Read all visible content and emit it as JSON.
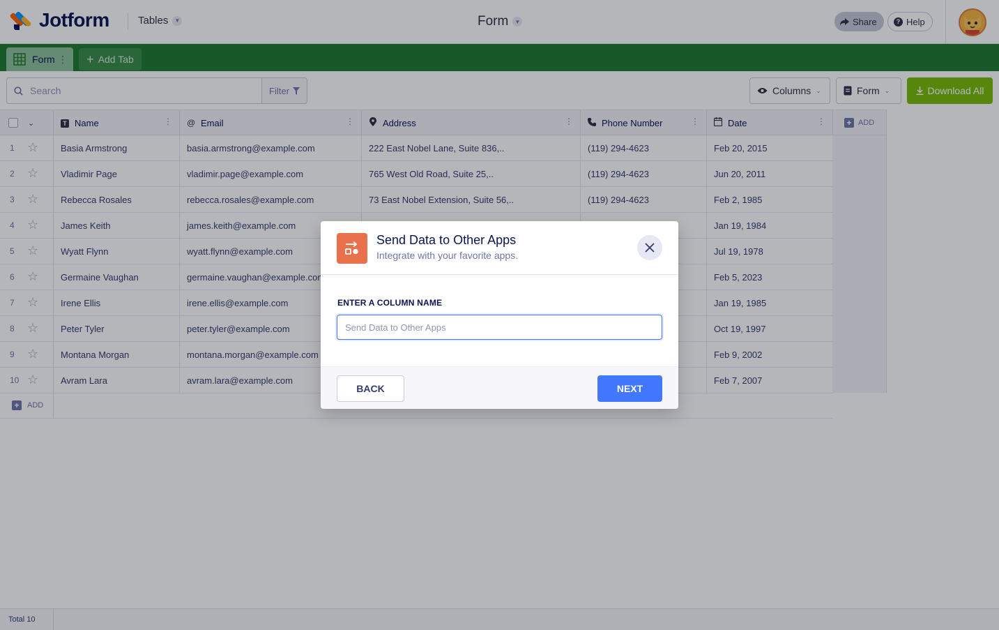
{
  "header": {
    "brand": "Jotform",
    "tables_label": "Tables",
    "form_title": "Form",
    "share_label": "Share",
    "help_label": "Help"
  },
  "tabs": {
    "active_tab": "Form",
    "add_tab_label": "Add Tab"
  },
  "toolbar": {
    "search_placeholder": "Search",
    "filter_label": "Filter",
    "columns_label": "Columns",
    "form_label": "Form",
    "download_label": "Download All"
  },
  "table": {
    "columns": [
      {
        "label": "Name",
        "icon": "text-icon"
      },
      {
        "label": "Email",
        "icon": "at-icon"
      },
      {
        "label": "Address",
        "icon": "location-pin-icon"
      },
      {
        "label": "Phone Number",
        "icon": "phone-icon"
      },
      {
        "label": "Date",
        "icon": "calendar-icon"
      }
    ],
    "add_column_label": "ADD",
    "add_row_label": "ADD",
    "rows": [
      {
        "num": "1",
        "name": "Basia Armstrong",
        "email": "basia.armstrong@example.com",
        "address": "222 East Nobel Lane, Suite 836,..",
        "phone": "(119) 294-4623",
        "date": "Feb 20, 2015"
      },
      {
        "num": "2",
        "name": "Vladimir Page",
        "email": "vladimir.page@example.com",
        "address": "765 West Old Road, Suite 25,..",
        "phone": "(119) 294-4623",
        "date": "Jun 20, 2011"
      },
      {
        "num": "3",
        "name": "Rebecca Rosales",
        "email": "rebecca.rosales@example.com",
        "address": "73 East Nobel Extension, Suite 56,..",
        "phone": "(119) 294-4623",
        "date": "Feb 2, 1985"
      },
      {
        "num": "4",
        "name": "James Keith",
        "email": "james.keith@example.com",
        "address": "",
        "phone": "",
        "date": "Jan 19, 1984"
      },
      {
        "num": "5",
        "name": "Wyatt Flynn",
        "email": "wyatt.flynn@example.com",
        "address": "",
        "phone": "",
        "date": "Jul 19, 1978"
      },
      {
        "num": "6",
        "name": "Germaine Vaughan",
        "email": "germaine.vaughan@example.com",
        "address": "",
        "phone": "",
        "date": "Feb 5, 2023"
      },
      {
        "num": "7",
        "name": "Irene Ellis",
        "email": "irene.ellis@example.com",
        "address": "",
        "phone": "",
        "date": "Jan 19, 1985"
      },
      {
        "num": "8",
        "name": "Peter Tyler",
        "email": "peter.tyler@example.com",
        "address": "",
        "phone": "",
        "date": "Oct 19, 1997"
      },
      {
        "num": "9",
        "name": "Montana Morgan",
        "email": "montana.morgan@example.com",
        "address": "",
        "phone": "",
        "date": "Feb 9, 2002"
      },
      {
        "num": "10",
        "name": "Avram Lara",
        "email": "avram.lara@example.com",
        "address": "",
        "phone": "",
        "date": "Feb 7, 2007"
      }
    ],
    "footer_total_label": "Total",
    "footer_total_count": "10"
  },
  "modal": {
    "title": "Send Data to Other Apps",
    "subtitle": "Integrate with your favorite apps.",
    "field_label": "ENTER A COLUMN NAME",
    "input_placeholder": "Send Data to Other Apps",
    "input_value": "",
    "back_label": "BACK",
    "next_label": "NEXT"
  },
  "colors": {
    "tab_bar": "#1f7a30",
    "download_button": "#78bb07",
    "modal_icon": "#e8704a",
    "primary_button": "#4277ff"
  }
}
